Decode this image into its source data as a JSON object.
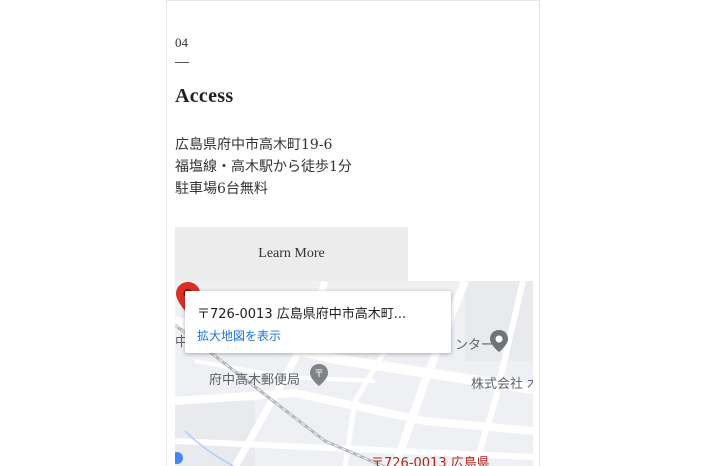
{
  "section": {
    "number": "04",
    "title": "Access",
    "address_lines": [
      "広島県府中市高木町19-6",
      "福塩線・高木駅から徒歩1分",
      "駐車場6台無料"
    ],
    "learn_more_label": "Learn More"
  },
  "map": {
    "info_title": "〒726-0013 広島県府中市高木町...",
    "info_link": "拡大地図を表示",
    "labels": {
      "post_office": "府中高木郵便局",
      "center": "ンター",
      "company": "株式会社",
      "company_tail": "木",
      "marker_address": "〒726-0013 広島県",
      "left_edge": "中"
    }
  },
  "colors": {
    "button_bg": "#ececec",
    "map_bg": "#eef0f3",
    "link": "#1a73e8",
    "marker": "#d93025"
  },
  "icons": {
    "marker": "map-pin-icon",
    "poi": "location-pin-icon",
    "post": "post-office-icon"
  }
}
